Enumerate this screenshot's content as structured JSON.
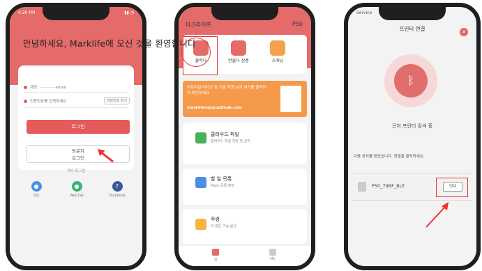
{
  "overlay_title": "안녕하세요, Marklife에 오신 것을 환영합니다",
  "phone1": {
    "status_time": "4:20 PM",
    "status_right": "▮▮ ◔",
    "account_field": "계정: ·············email",
    "password_placeholder": "인증번호를 입력하세요",
    "forgot_label": "비밀번호 찾기",
    "login_label": "로그인",
    "visitor_label_line1": "방문자",
    "visitor_label_line2": "로그인",
    "other_login_label": "기타 로그인",
    "social": [
      {
        "icon": "qq-icon",
        "label": "QQ",
        "color": "#4a90e2"
      },
      {
        "icon": "wechat-icon",
        "label": "WeChat",
        "color": "#3cb371"
      },
      {
        "icon": "facebook-icon",
        "label": "Facebook",
        "color": "#3b5998"
      }
    ]
  },
  "phone2": {
    "title": "마크라이프",
    "model": "P50",
    "tools": [
      {
        "label": "출력다",
        "icon": "print-icon",
        "color": "#e56b6b"
      },
      {
        "label": "만들다 상품",
        "icon": "template-icon",
        "color": "#e56b6b"
      },
      {
        "label": "스캐닝",
        "icon": "scan-icon",
        "color": "#f5a04a"
      }
    ],
    "banner_text": "튜토리얼 비디오 및 기술 지원 보기 여기를 클릭하여 확인하세요",
    "banner_email": "marklifevip@outlook.com",
    "cards": [
      {
        "title": "클라우드 파일",
        "subtitle": "클라우드 파일 저장 및 관리",
        "icon": "folder-icon",
        "color": "#4cb05a"
      },
      {
        "title": "할 일 목록",
        "subtitle": "Mark 목록 출력",
        "icon": "list-icon",
        "color": "#4a90e2"
      },
      {
        "title": "주령",
        "subtitle": "더 많은 기능 옵션",
        "icon": "note-icon",
        "color": "#f5b640"
      }
    ],
    "tabs": [
      {
        "label": "집",
        "icon": "home-icon"
      },
      {
        "label": "Me",
        "icon": "user-icon"
      }
    ]
  },
  "phone3": {
    "status_left": "Service",
    "title": "프린터 연결",
    "searching": "근처 프린터 검색 중",
    "found_text": "다음 장치를 찾았습니다. 연결을 클릭하세요.",
    "device_name": "P50_79BF_BLE",
    "connect_label": "잇다"
  },
  "colors": {
    "brand_red": "#e56b6b",
    "orange": "#f59a4a",
    "highlight": "#ee3333"
  }
}
